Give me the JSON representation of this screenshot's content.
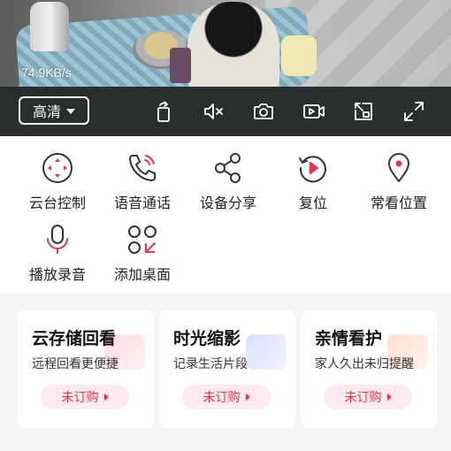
{
  "colors": {
    "accent": "#e8334a",
    "toolbar_bg": "#2b2e2f",
    "subscribe_bg": "#fdeaee",
    "cards_bg": "#f7f4f7"
  },
  "video": {
    "bitrate": "74.9KB/s"
  },
  "toolbar": {
    "quality_label": "高清",
    "tools": [
      "rotate-screen-icon",
      "mute-icon",
      "camera-icon",
      "video-record-icon",
      "picture-in-picture-icon",
      "fullscreen-icon"
    ]
  },
  "functions": [
    {
      "label": "云台控制",
      "icon": "ptz-control-icon"
    },
    {
      "label": "语音通话",
      "icon": "phone-call-icon"
    },
    {
      "label": "设备分享",
      "icon": "share-icon"
    },
    {
      "label": "复位",
      "icon": "reset-icon"
    },
    {
      "label": "常看位置",
      "icon": "location-pin-icon"
    },
    {
      "label": "播放录音",
      "icon": "microphone-icon"
    },
    {
      "label": "添加桌面",
      "icon": "add-to-desktop-icon"
    }
  ],
  "cards": [
    {
      "title": "云存储回看",
      "subtitle": "远程回看更便捷",
      "action": "未订购"
    },
    {
      "title": "时光缩影",
      "subtitle": "记录生活片段",
      "action": "未订购"
    },
    {
      "title": "亲情看护",
      "subtitle": "家人久出未归提醒",
      "action": "未订购"
    }
  ]
}
